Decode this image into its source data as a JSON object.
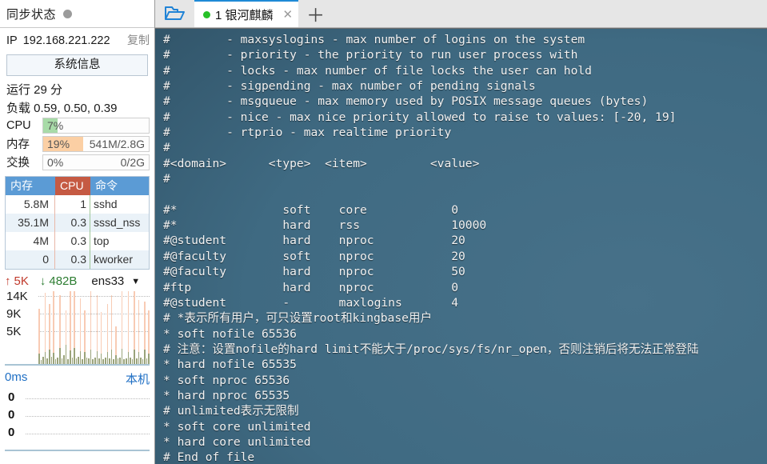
{
  "sidebar": {
    "sync": {
      "label": "同步状态",
      "dot_color": "#9b9b9b"
    },
    "ip": {
      "key": "IP",
      "value": "192.168.221.222",
      "copy_label": "复制"
    },
    "sysinfo_button": "系统信息",
    "uptime": "运行 29 分",
    "load": "负载 0.59, 0.50, 0.39",
    "meters": [
      {
        "name": "CPU",
        "percent": "7%",
        "percent_value": 7,
        "right": "",
        "color": "#a8dba8"
      },
      {
        "name": "内存",
        "percent": "19%",
        "percent_value": 19,
        "right": "541M/2.8G",
        "color": "#fbcfa4"
      },
      {
        "name": "交换",
        "percent": "0%",
        "percent_value": 0,
        "right": "0/2G",
        "color": "#cfcfcf"
      }
    ],
    "process_table": {
      "headers": {
        "mem": "内存",
        "cpu": "CPU",
        "cmd": "命令"
      },
      "rows": [
        {
          "mem": "5.8M",
          "cpu": "1",
          "cmd": "sshd"
        },
        {
          "mem": "35.1M",
          "cpu": "0.3",
          "cmd": "sssd_nss"
        },
        {
          "mem": "4M",
          "cpu": "0.3",
          "cmd": "top"
        },
        {
          "mem": "0",
          "cpu": "0.3",
          "cmd": "kworker"
        }
      ]
    },
    "network": {
      "upload": "5K",
      "download": "482B",
      "interface": "ens33",
      "y_labels": [
        "14K",
        "9K",
        "5K"
      ]
    },
    "latency": {
      "scale": "0ms",
      "host": "本机",
      "y_labels": [
        "0",
        "0",
        "0"
      ]
    }
  },
  "tabbar": {
    "folder_icon": "open-folder-icon",
    "tab": {
      "title": "1 银河麒麟",
      "status_dot": "#27c128",
      "close": "✕"
    },
    "new_tab": "＋"
  },
  "terminal": {
    "background": "#3d6b85",
    "foreground": "#f2f2f2",
    "content": "#        - maxsyslogins - max number of logins on the system\n#        - priority - the priority to run user process with\n#        - locks - max number of file locks the user can hold\n#        - sigpending - max number of pending signals\n#        - msgqueue - max memory used by POSIX message queues (bytes)\n#        - nice - max nice priority allowed to raise to values: [-20, 19]\n#        - rtprio - max realtime priority\n#\n#<domain>      <type>  <item>         <value>\n#\n\n#*               soft    core            0\n#*               hard    rss             10000\n#@student        hard    nproc           20\n#@faculty        soft    nproc           20\n#@faculty        hard    nproc           50\n#ftp             hard    nproc           0\n#@student        -       maxlogins       4\n# *表示所有用户，可只设置root和kingbase用户\n* soft nofile 65536\n# 注意：设置nofile的hard limit不能大于/proc/sys/fs/nr_open，否则注销后将无法正常登陆\n* hard nofile 65535\n* soft nproc 65536\n* hard nproc 65535\n# unlimited表示无限制\n* soft core unlimited\n* hard core unlimited\n# End of file"
  }
}
